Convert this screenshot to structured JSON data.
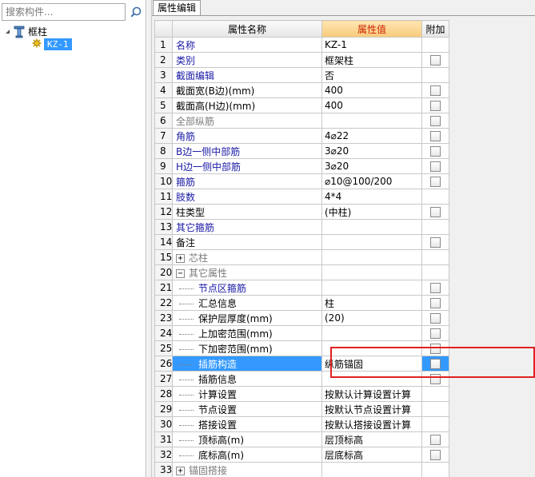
{
  "search": {
    "placeholder": "搜索构件..."
  },
  "tree": {
    "root_label": "框柱",
    "child_label": "KZ-1"
  },
  "tab": {
    "label": "属性编辑"
  },
  "grid": {
    "headers": {
      "name": "属性名称",
      "value": "属性值",
      "add": "附加"
    },
    "rows": [
      {
        "num": "1",
        "name": "名称",
        "value": "KZ-1",
        "cb": false
      },
      {
        "num": "2",
        "name": "类别",
        "value": "框架柱",
        "cb": true
      },
      {
        "num": "3",
        "name": "截面编辑",
        "value": "否",
        "cb": false
      },
      {
        "num": "4",
        "name": "截面宽(B边)(mm)",
        "value": "400",
        "cb": true
      },
      {
        "num": "5",
        "name": "截面高(H边)(mm)",
        "value": "400",
        "cb": true
      },
      {
        "num": "6",
        "name": "全部纵筋",
        "value": "",
        "cb": true
      },
      {
        "num": "7",
        "name": "角筋",
        "value": "4⌀22",
        "cb": true
      },
      {
        "num": "8",
        "name": "B边一侧中部筋",
        "value": "3⌀20",
        "cb": true
      },
      {
        "num": "9",
        "name": "H边一侧中部筋",
        "value": "3⌀20",
        "cb": true
      },
      {
        "num": "10",
        "name": "箍筋",
        "value": "⌀10@100/200",
        "cb": true
      },
      {
        "num": "11",
        "name": "肢数",
        "value": "4*4",
        "cb": false
      },
      {
        "num": "12",
        "name": "柱类型",
        "value": "(中柱)",
        "cb": true
      },
      {
        "num": "13",
        "name": "其它箍筋",
        "value": "",
        "cb": false
      },
      {
        "num": "14",
        "name": "备注",
        "value": "",
        "cb": true
      },
      {
        "num": "15",
        "name": "芯柱",
        "value": "",
        "cb": false
      },
      {
        "num": "20",
        "name": "其它属性",
        "value": "",
        "cb": false
      },
      {
        "num": "21",
        "name": "节点区箍筋",
        "value": "",
        "cb": true
      },
      {
        "num": "22",
        "name": "汇总信息",
        "value": "柱",
        "cb": true
      },
      {
        "num": "23",
        "name": "保护层厚度(mm)",
        "value": "(20)",
        "cb": true
      },
      {
        "num": "24",
        "name": "上加密范围(mm)",
        "value": "",
        "cb": true
      },
      {
        "num": "25",
        "name": "下加密范围(mm)",
        "value": "",
        "cb": true
      },
      {
        "num": "26",
        "name": "插筋构造",
        "value": "纵筋锚固",
        "cb": true
      },
      {
        "num": "27",
        "name": "插筋信息",
        "value": "",
        "cb": true
      },
      {
        "num": "28",
        "name": "计算设置",
        "value": "按默认计算设置计算",
        "cb": false
      },
      {
        "num": "29",
        "name": "节点设置",
        "value": "按默认节点设置计算",
        "cb": false
      },
      {
        "num": "30",
        "name": "搭接设置",
        "value": "按默认搭接设置计算",
        "cb": false
      },
      {
        "num": "31",
        "name": "顶标高(m)",
        "value": "层顶标高",
        "cb": true
      },
      {
        "num": "32",
        "name": "底标高(m)",
        "value": "层底标高",
        "cb": true
      },
      {
        "num": "33",
        "name": "锚固搭接",
        "value": "",
        "cb": false
      }
    ]
  },
  "colors": {
    "selection": "#3399ff",
    "highlight_box": "#e02020",
    "link_text": "#1a1aa6",
    "header_value_text": "#cc2200"
  }
}
